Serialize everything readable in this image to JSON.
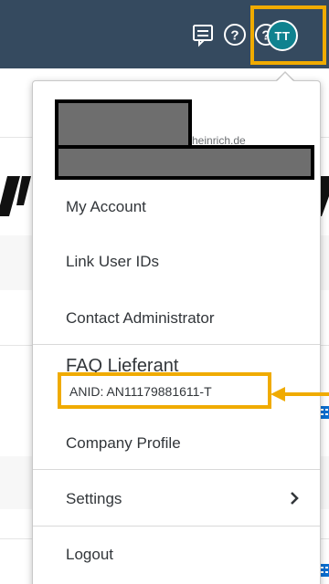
{
  "topbar": {
    "icons": [
      "feedback-icon",
      "help-icon",
      "help-icon"
    ],
    "avatar_initials": "TT",
    "colors": {
      "bar": "#354a5f",
      "avatar": "#0f828f",
      "highlight": "#f0ab00"
    }
  },
  "user_menu": {
    "email_fragment": "heinrich.de",
    "items": [
      {
        "label": "My Account"
      },
      {
        "label": "Link User IDs"
      },
      {
        "label": "Contact Administrator"
      }
    ],
    "faq_label": "FAQ Lieferant",
    "anid": "ANID: AN11179881611-T",
    "company_profile": "Company Profile",
    "settings": "Settings",
    "logout": "Logout"
  }
}
